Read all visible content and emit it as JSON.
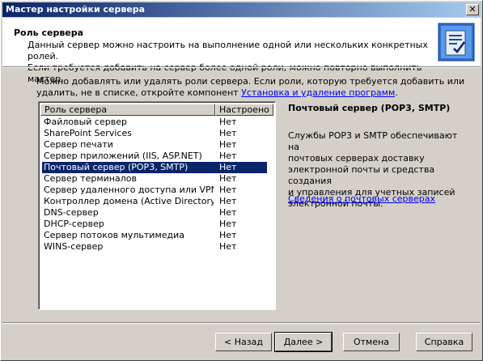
{
  "window": {
    "title": "Мастер настройки сервера",
    "close_glyph": "✕"
  },
  "header": {
    "title": "Роль сервера",
    "description": "Данный сервер можно настроить на выполнение одной или нескольких конкретных ролей.\nЕсли требуется добавить на сервер более одной роли, можно повторно выполнить мастер."
  },
  "intro": {
    "text": "Можно добавлять или удалять роли сервера. Если роли, которую требуется добавить или удалить, не в списке, откройте компонент ",
    "link": "Установка и удаление программ",
    "suffix": "."
  },
  "list": {
    "columns": [
      "Роль сервера",
      "Настроено"
    ],
    "rows": [
      {
        "role": "Файловый сервер",
        "configured": "Нет"
      },
      {
        "role": "SharePoint Services",
        "configured": "Нет"
      },
      {
        "role": "Сервер печати",
        "configured": "Нет"
      },
      {
        "role": "Сервер приложений (IIS, ASP.NET)",
        "configured": "Нет"
      },
      {
        "role": "Почтовый сервер (POP3, SMTP)",
        "configured": "Нет",
        "selected": true
      },
      {
        "role": "Сервер терминалов",
        "configured": "Нет"
      },
      {
        "role": "Сервер удаленного доступа или VPN-с...",
        "configured": "Нет"
      },
      {
        "role": "Контроллер домена (Active Directory)",
        "configured": "Нет"
      },
      {
        "role": "DNS-сервер",
        "configured": "Нет"
      },
      {
        "role": "DHCP-сервер",
        "configured": "Нет"
      },
      {
        "role": "Сервер потоков мультимедиа",
        "configured": "Нет"
      },
      {
        "role": "WINS-сервер",
        "configured": "Нет"
      }
    ]
  },
  "detail": {
    "title": "Почтовый сервер (POP3, SMTP)",
    "description": "Службы POP3 и SMTP обеспечивают на\nпочтовых серверах доставку\nэлектронной почты и средства создания\nи управления для учетных записей\nэлектронной почты.",
    "link": "Сведения о почтовых серверах"
  },
  "buttons": {
    "back": "< Назад",
    "next": "Далее >",
    "cancel": "Отмена",
    "help": "Справка"
  },
  "colors": {
    "selection": "#0a246a",
    "face": "#d4d0c8",
    "link": "#0000ee"
  },
  "icons": {
    "header": "wizard-server-icon"
  }
}
